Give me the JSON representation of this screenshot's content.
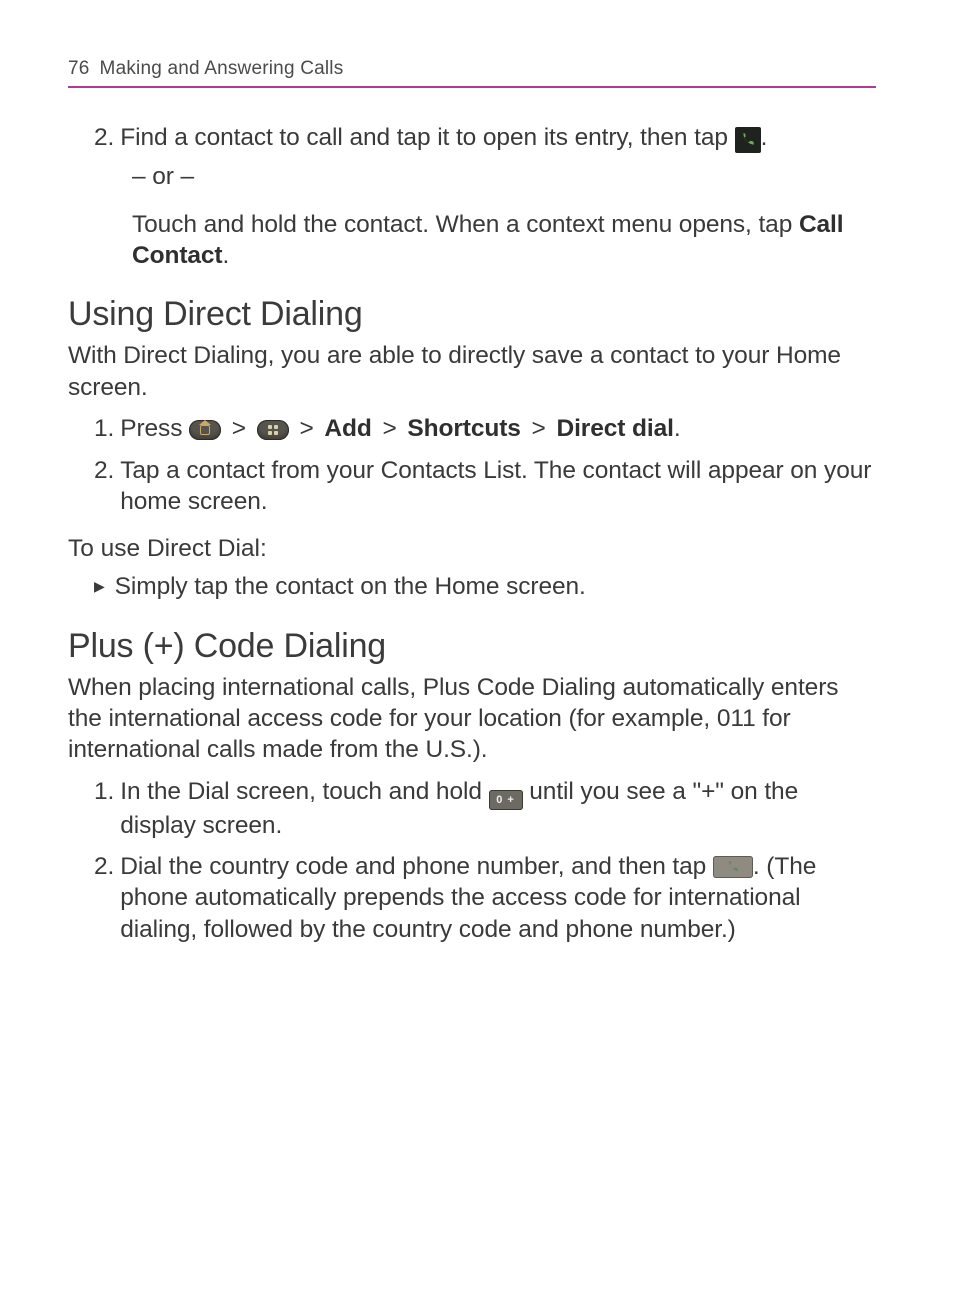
{
  "header": {
    "page_number": "76",
    "chapter_title": "Making and Answering Calls"
  },
  "block_a": {
    "step2_num": "2.",
    "step2_text_a": "Find a contact to call and tap it to open its entry, then tap ",
    "step2_text_b": ".",
    "or_text": "– or –",
    "alt_text_a": "Touch and hold the contact. When a context menu opens, tap ",
    "alt_bold": "Call Contact",
    "alt_text_b": "."
  },
  "section_direct": {
    "heading": "Using Direct Dialing",
    "intro": "With Direct Dialing, you are able to directly save a contact to your Home screen.",
    "step1_num": "1.",
    "step1_a": "Press ",
    "gt": ">",
    "add": "Add",
    "shortcuts": "Shortcuts",
    "direct_dial": "Direct dial",
    "step1_end": ".",
    "step2_num": "2.",
    "step2_text": "Tap a contact from your Contacts List. The contact will appear on your home screen.",
    "subhead": "To use Direct Dial:",
    "bullet": "Simply tap the contact on the Home screen."
  },
  "section_plus": {
    "heading": "Plus (+) Code Dialing",
    "intro": "When placing international calls, Plus Code Dialing automatically enters the international access code for your location (for example, 011 for international calls made from the U.S.).",
    "step1_num": "1.",
    "step1_a": "In the Dial screen, touch and hold ",
    "step1_b": " until you see a \"+\" on the display screen.",
    "step2_num": "2.",
    "step2_a": "Dial the country code and phone number, and then tap ",
    "step2_b": ". (The phone automatically prepends the access code for international dialing, followed by the country code and phone number.)"
  },
  "icons": {
    "call_dark": "call-icon",
    "home_pill": "home-button-icon",
    "menu_pill": "menu-button-icon",
    "key_zero": "zero-plus-key-icon",
    "key_zero_label": "0 +",
    "call_btn": "call-button-icon"
  }
}
